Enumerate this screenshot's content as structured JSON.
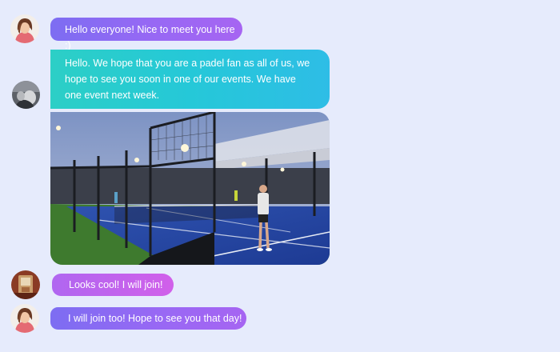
{
  "chat": {
    "messages": [
      {
        "sender": "user-a",
        "text": "Hello everyone! Nice to meet you here :)"
      },
      {
        "sender": "user-b",
        "text": "Hello. We hope that you are a padel  fan as all of us, we hope to see you soon in one of our events. We have one event next week."
      },
      {
        "sender": "user-b",
        "type": "photo"
      },
      {
        "sender": "user-c",
        "text": "Looks cool! I will join!"
      },
      {
        "sender": "user-a",
        "text": "I will join too! Hope to see you that day!"
      }
    ]
  },
  "colors": {
    "background": "#e6ebfc",
    "bubble_purple": "#8a6af3",
    "bubble_pink": "#c862ed",
    "bubble_teal": "#2ac9d6"
  }
}
